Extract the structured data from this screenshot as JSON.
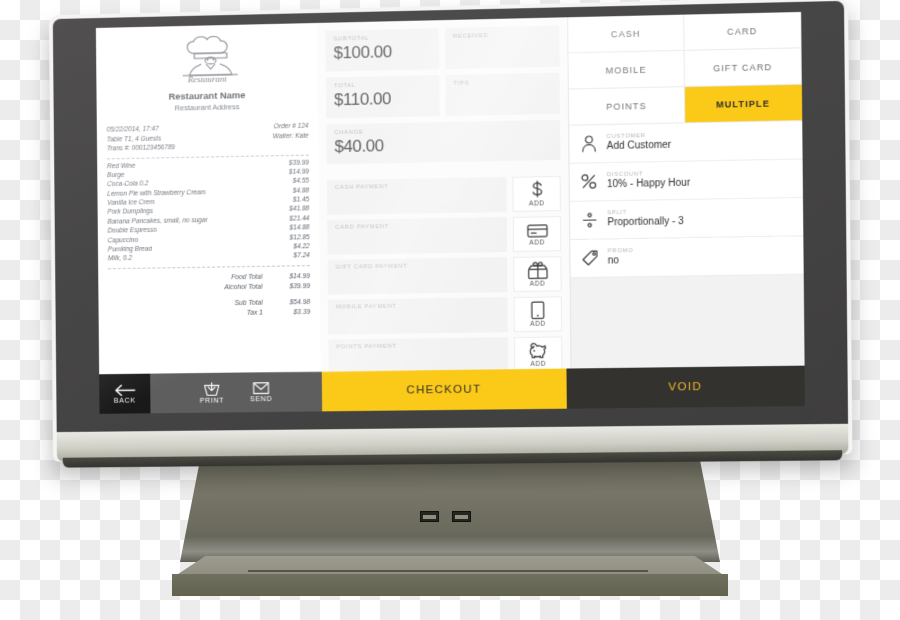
{
  "receipt": {
    "logo_caption": "Restaurant",
    "name": "Restaurant Name",
    "address": "Restaurant Address",
    "date_time": "05/22/2014,  17:47",
    "order_no": "Order # 124",
    "table_guests": "Table T1, 4 Guests",
    "waiter": "Waiter: Kate",
    "trans": "Trans #: 000123456789",
    "items": [
      {
        "name": "Red Wine",
        "price": "$39.99"
      },
      {
        "name": "Burge",
        "price": "$14.99"
      },
      {
        "name": "Coca-Cola 0.2",
        "price": "$4.55"
      },
      {
        "name": "Lemon Pie with Strawberry Cream",
        "price": "$4.88"
      },
      {
        "name": "Vanilla Ice Crem",
        "price": "$1.45"
      },
      {
        "name": "Pork Dumplings",
        "price": "$41.88"
      },
      {
        "name": "Banana Pancakes, small, no sugar",
        "price": "$21.44"
      },
      {
        "name": "Double Espresso",
        "price": "$14.88"
      },
      {
        "name": "Capuccino",
        "price": "$12.85"
      },
      {
        "name": "Pumking Bread",
        "price": "$4.22"
      },
      {
        "name": "Milk, 0.2",
        "price": "$7.24"
      }
    ],
    "totals_group_1": [
      {
        "label": "Food Total",
        "value": "$14.99"
      },
      {
        "label": "Alcohol Total",
        "value": "$39.99"
      }
    ],
    "totals_group_2": [
      {
        "label": "Sub Total",
        "value": "$54.98"
      },
      {
        "label": "Tax 1",
        "value": "$3.39"
      }
    ]
  },
  "amounts": {
    "subtotal_label": "SUBTOTAL",
    "subtotal_value": "$100.00",
    "received_label": "RECEIVED",
    "received_value": "",
    "total_label": "TOTAL",
    "total_value": "$110.00",
    "tips_label": "TIPS",
    "tips_value": "",
    "change_label": "CHANGE",
    "change_value": "$40.00"
  },
  "payments": {
    "add_label": "ADD",
    "rows": [
      {
        "label": "CASH PAYMENT",
        "icon": "dollar-icon"
      },
      {
        "label": "CARD PAYMENT",
        "icon": "credit-card-icon"
      },
      {
        "label": "GIFT CARD PAYMENT",
        "icon": "gift-icon"
      },
      {
        "label": "MOBILE PAYMENT",
        "icon": "phone-icon"
      },
      {
        "label": "POINTS PAYMENT",
        "icon": "piggy-bank-icon"
      }
    ]
  },
  "tabs": [
    {
      "label": "CASH",
      "active": false
    },
    {
      "label": "CARD",
      "active": false
    },
    {
      "label": "MOBILE",
      "active": false
    },
    {
      "label": "GIFT CARD",
      "active": false
    },
    {
      "label": "POINTS",
      "active": false
    },
    {
      "label": "MULTIPLE",
      "active": true
    }
  ],
  "options": [
    {
      "label": "CUSTOMER",
      "value": "Add Customer",
      "icon": "person-icon"
    },
    {
      "label": "DISCOUNT",
      "value": "10% - Happy Hour",
      "icon": "percent-icon"
    },
    {
      "label": "SPLIT",
      "value": "Proportionally - 3",
      "icon": "divide-icon"
    },
    {
      "label": "PROMO",
      "value": "no",
      "icon": "tag-icon"
    }
  ],
  "bottombar": {
    "back": "BACK",
    "print": "PRINT",
    "send": "SEND",
    "checkout": "CHECKOUT",
    "void": "VOID"
  },
  "colors": {
    "accent_yellow": "#fbc918",
    "void_text": "#f0b92a",
    "bar_dark": "#33322f",
    "back_black": "#191919"
  }
}
